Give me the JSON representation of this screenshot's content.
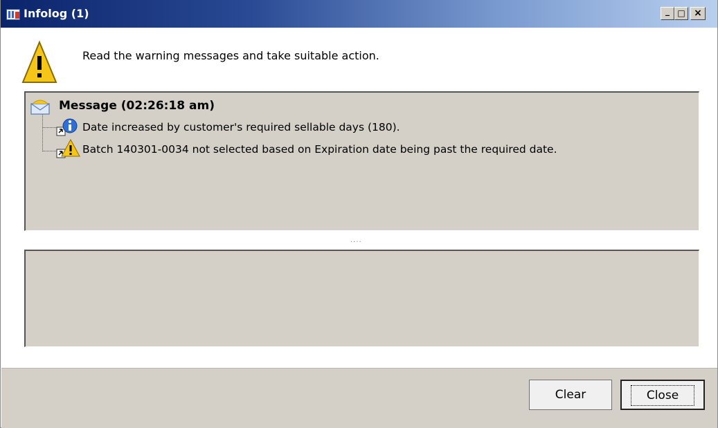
{
  "window": {
    "title": "Infolog (1)",
    "controls": {
      "minimize": "_",
      "maximize": "□",
      "close": "×"
    }
  },
  "header": {
    "icon": "warning-icon",
    "instruction": "Read the warning messages and take suitable action."
  },
  "messages": {
    "group_icon": "message-envelope-icon",
    "group_title": "Message (02:26:18 am)",
    "items": [
      {
        "icon": "info-icon",
        "text": "Date increased by customer's required sellable days (180)."
      },
      {
        "icon": "warning-icon",
        "text": "Batch 140301-0034 not selected based on Expiration date being past the required date."
      }
    ]
  },
  "splitter": {
    "grip": "····"
  },
  "buttons": {
    "clear": "Clear",
    "close": "Close"
  },
  "colors": {
    "title_gradient_start": "#0a246a",
    "title_gradient_end": "#b9cfee",
    "panel_bg": "#d4d0c8",
    "warning_yellow": "#f5c518",
    "info_blue": "#2f6fd6"
  }
}
